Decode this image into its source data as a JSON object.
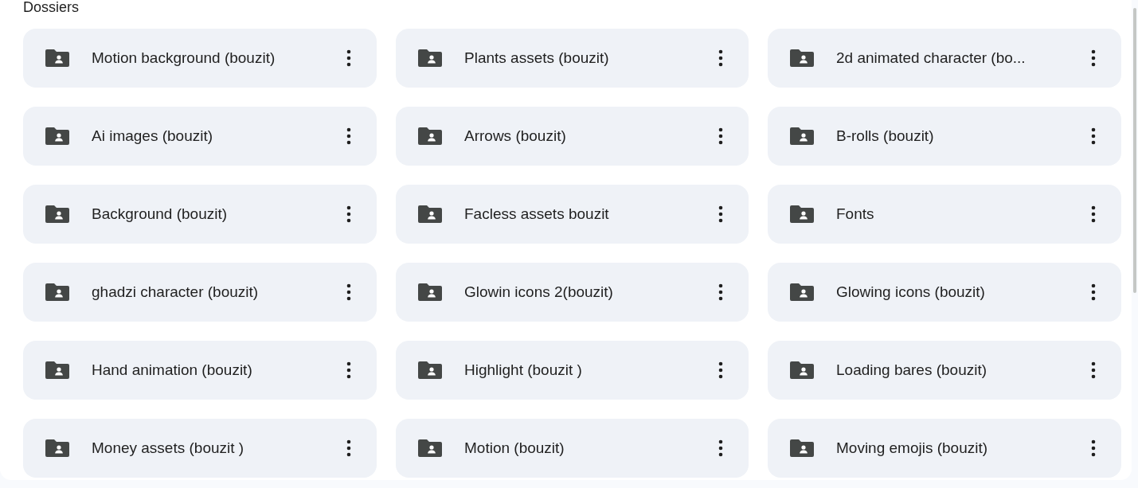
{
  "section": {
    "title": "Dossiers"
  },
  "folders": [
    {
      "name": "Motion background (bouzit)"
    },
    {
      "name": "Plants assets (bouzit)"
    },
    {
      "name": "2d animated character (bo..."
    },
    {
      "name": "Ai images (bouzit)"
    },
    {
      "name": "Arrows (bouzit)"
    },
    {
      "name": "B-rolls (bouzit)"
    },
    {
      "name": "Background (bouzit)"
    },
    {
      "name": "Facless assets bouzit"
    },
    {
      "name": "Fonts"
    },
    {
      "name": "ghadzi character (bouzit)"
    },
    {
      "name": "Glowin icons 2(bouzit)"
    },
    {
      "name": "Glowing icons (bouzit)"
    },
    {
      "name": "Hand animation (bouzit)"
    },
    {
      "name": "Highlight (bouzit )"
    },
    {
      "name": "Loading bares (bouzit)"
    },
    {
      "name": "Money assets (bouzit )"
    },
    {
      "name": "Motion (bouzit)"
    },
    {
      "name": "Moving emojis (bouzit)"
    }
  ]
}
